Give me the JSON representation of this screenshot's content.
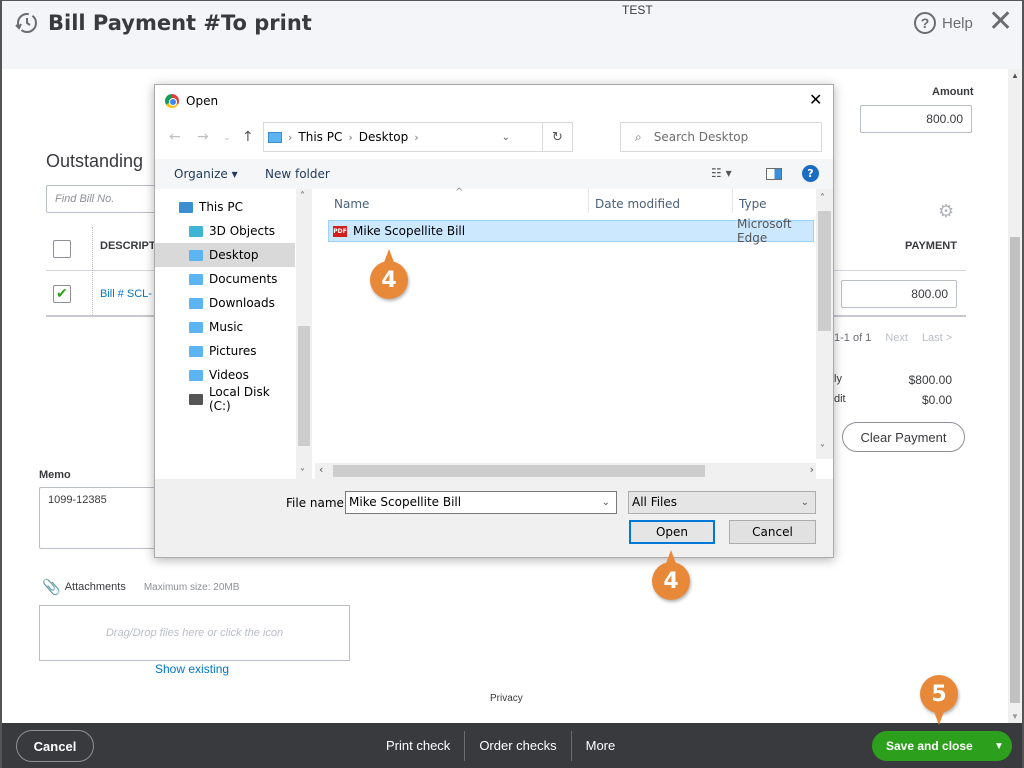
{
  "header": {
    "title": "Bill Payment #To print",
    "company": "TEST",
    "help_label": "Help",
    "close_icon": "close-icon"
  },
  "amount": {
    "label": "Amount",
    "value": "800.00"
  },
  "outstanding": {
    "title": "Outstanding",
    "find_placeholder": "Find Bill No.",
    "columns": {
      "description": "DESCRIPTION",
      "payment": "PAYMENT"
    },
    "rows": [
      {
        "checked": true,
        "description": "Bill # SCL-",
        "payment": "800.00"
      }
    ],
    "pager": {
      "range": "1-1 of 1",
      "next": "Next",
      "last": "Last >"
    },
    "summary": [
      {
        "label": "ly",
        "value": "$800.00"
      },
      {
        "label": "dit",
        "value": "$0.00"
      }
    ],
    "clear_label": "Clear Payment"
  },
  "memo": {
    "label": "Memo",
    "value": "1099-12385"
  },
  "attachments": {
    "label": "Attachments",
    "max_size": "Maximum size: 20MB",
    "drop_hint": "Drag/Drop files here or click the icon",
    "show_existing": "Show existing"
  },
  "privacy": "Privacy",
  "footer": {
    "cancel": "Cancel",
    "print_check": "Print check",
    "order_checks": "Order checks",
    "more": "More",
    "save_close": "Save and close"
  },
  "dialog": {
    "title": "Open",
    "path": [
      "This PC",
      "Desktop"
    ],
    "search_placeholder": "Search Desktop",
    "organize": "Organize ▾",
    "new_folder": "New folder",
    "tree": [
      {
        "label": "This PC",
        "color": "#3a8fd0"
      },
      {
        "label": "3D Objects",
        "color": "#3fb5d6"
      },
      {
        "label": "Desktop",
        "color": "#5cb4f0",
        "selected": true
      },
      {
        "label": "Documents",
        "color": "#5cb4f0"
      },
      {
        "label": "Downloads",
        "color": "#5cb4f0"
      },
      {
        "label": "Music",
        "color": "#5cb4f0"
      },
      {
        "label": "Pictures",
        "color": "#5cb4f0"
      },
      {
        "label": "Videos",
        "color": "#5cb4f0"
      },
      {
        "label": "Local Disk (C:)",
        "color": "#555555"
      }
    ],
    "columns": {
      "name": "Name",
      "date": "Date modified",
      "type": "Type"
    },
    "files": [
      {
        "name": "Mike Scopellite Bill",
        "type": "Microsoft Edge",
        "icon": "pdf-icon",
        "selected": true
      }
    ],
    "file_name_label": "File name:",
    "file_name_value": "Mike Scopellite Bill",
    "file_type": "All Files",
    "open_label": "Open",
    "cancel_label": "Cancel"
  },
  "callouts": [
    {
      "number": "4"
    },
    {
      "number": "4"
    },
    {
      "number": "5"
    }
  ],
  "colors": {
    "accent_green": "#2ca01c",
    "link_blue": "#0077c5",
    "callout_orange": "#e8893a",
    "footer_bg": "#393a3d"
  }
}
